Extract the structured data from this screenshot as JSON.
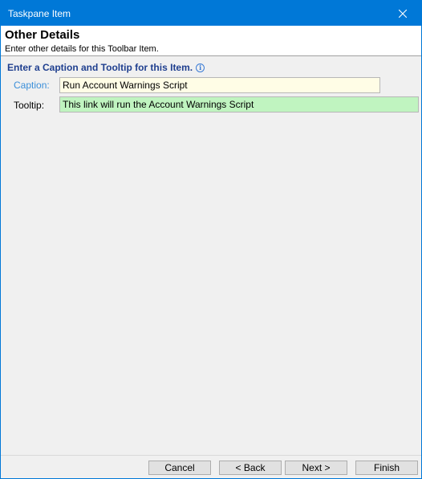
{
  "window": {
    "title": "Taskpane Item",
    "close_glyph": "close-icon"
  },
  "header": {
    "title": "Other Details",
    "subtitle": "Enter other details for this Toolbar Item."
  },
  "section": {
    "heading": "Enter a Caption and Tooltip for this Item.",
    "info_icon": "info-icon"
  },
  "fields": {
    "caption_label": "Caption:",
    "caption_value": "Run Account Warnings Script",
    "tooltip_label": "Tooltip:",
    "tooltip_value": "This link will run the Account Warnings Script"
  },
  "buttons": {
    "cancel": "Cancel",
    "back": "< Back",
    "next": "Next >",
    "finish": "Finish"
  },
  "colors": {
    "titlebar": "#0078d7",
    "caption_bg": "#fffde6",
    "tooltip_bg": "#c0f4c0",
    "heading_text": "#1f3f8f",
    "caption_label": "#3b8fd9"
  }
}
